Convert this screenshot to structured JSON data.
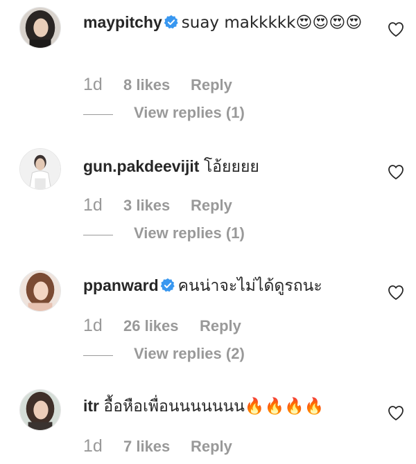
{
  "comments": [
    {
      "username": "maypitchy",
      "verified": true,
      "text": "suay makkkkk😍😍😍😍",
      "time": "1d",
      "likes": "8 likes",
      "reply_label": "Reply",
      "view_replies": "View replies (1)"
    },
    {
      "username": "gun.pakdeevijit",
      "verified": false,
      "text": "โอ้ยยยย",
      "time": "1d",
      "likes": "3 likes",
      "reply_label": "Reply",
      "view_replies": "View replies (1)"
    },
    {
      "username": "ppanward",
      "verified": true,
      "text": "คนน่าจะไม่ได้ดูรถนะ",
      "time": "1d",
      "likes": "26 likes",
      "reply_label": "Reply",
      "view_replies": "View replies (2)"
    },
    {
      "username": "itr",
      "verified": false,
      "text": "อื้อหือเพื่อนนนนนนน🔥🔥🔥🔥",
      "time": "1d",
      "likes": "7 likes",
      "reply_label": "Reply"
    }
  ],
  "icons": {
    "verified_badge": "verified-badge-icon",
    "like": "heart-outline-icon"
  },
  "colors": {
    "text_primary": "#262626",
    "text_secondary": "#999999",
    "verified_blue": "#3897f0"
  }
}
